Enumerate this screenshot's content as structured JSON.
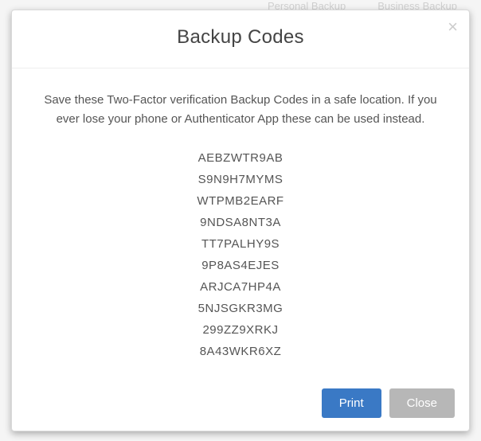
{
  "background": {
    "nav_items": [
      "Personal Backup",
      "Business Backup"
    ]
  },
  "modal": {
    "title": "Backup Codes",
    "close_label": "×",
    "instructions": "Save these Two-Factor verification Backup Codes in a safe location. If you ever lose your phone or Authenticator App these can be used instead.",
    "codes": [
      "AEBZWTR9AB",
      "S9N9H7MYMS",
      "WTPMB2EARF",
      "9NDSA8NT3A",
      "TT7PALHY9S",
      "9P8AS4EJES",
      "ARJCA7HP4A",
      "5NJSGKR3MG",
      "299ZZ9XRKJ",
      "8A43WKR6XZ"
    ],
    "buttons": {
      "print": "Print",
      "close": "Close"
    }
  }
}
